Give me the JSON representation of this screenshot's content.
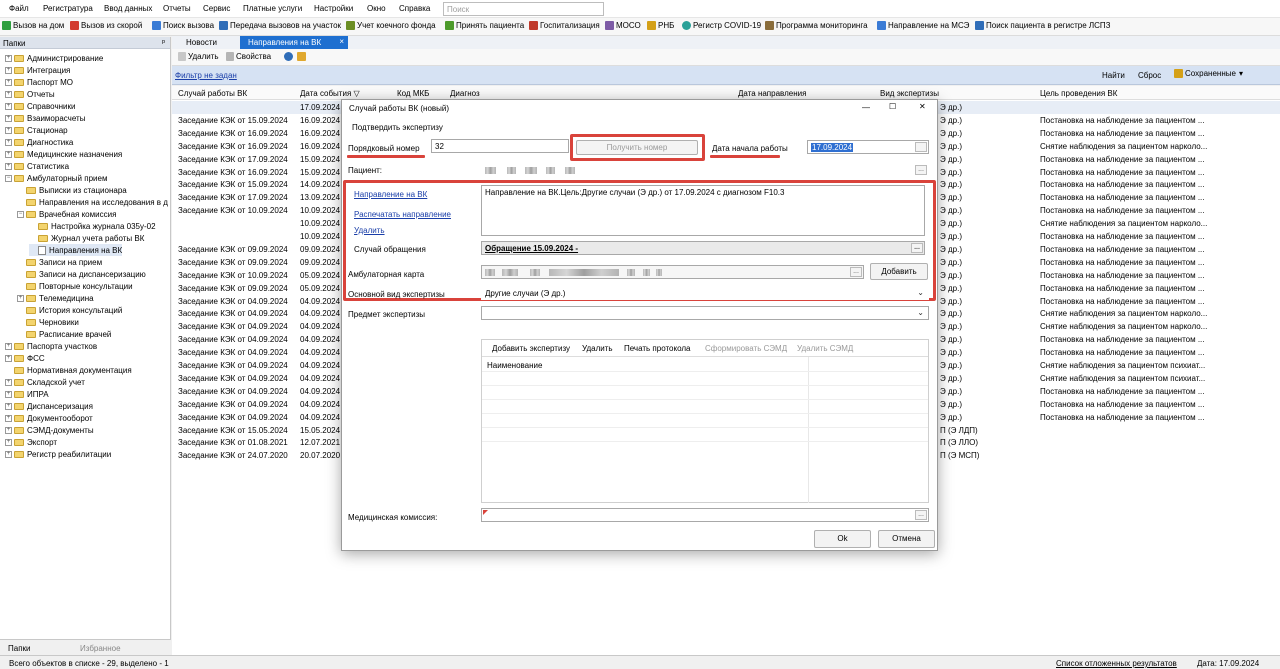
{
  "menu": [
    "Файл",
    "Регистратура",
    "Ввод данных",
    "Отчеты",
    "Сервис",
    "Платные услуги",
    "Настройки",
    "Окно",
    "Справка"
  ],
  "search": {
    "placeholder": "Поиск"
  },
  "toolbar": [
    "Вызов на дом",
    "Вызов из скорой",
    "Поиск вызова",
    "Передача вызовов на участок",
    "Учет коечного фонда",
    "Принять пациента",
    "Госпитализация",
    "МОСО",
    "РНБ",
    "Регистр COVID-19",
    "Программа мониторинга",
    "Направление на МСЭ",
    "Поиск пациента в регистре ЛСПЗ"
  ],
  "toolbar_icon_colors": [
    "#2e9e3e",
    "#d23b2f",
    "#3a7bd5",
    "#2f6db8",
    "#6b8e23",
    "#4c9a2a",
    "#c0392b",
    "#7d5ba6",
    "#d4a017",
    "#2aa198",
    "#8a6d3b",
    "#3a7bd5",
    "#2f6db8"
  ],
  "left_panel": {
    "title": "Папки",
    "pin": "ᵖ",
    "tree": [
      {
        "label": "Администрирование",
        "level": 0,
        "type": "folder",
        "tog": "+"
      },
      {
        "label": "Интеграция",
        "level": 0,
        "type": "folder",
        "tog": "+"
      },
      {
        "label": "Паспорт МО",
        "level": 0,
        "type": "folder",
        "tog": "+"
      },
      {
        "label": "Отчеты",
        "level": 0,
        "type": "folder",
        "tog": "+"
      },
      {
        "label": "Справочники",
        "level": 0,
        "type": "folder",
        "tog": "+"
      },
      {
        "label": "Взаиморасчеты",
        "level": 0,
        "type": "folder",
        "tog": "+"
      },
      {
        "label": "Стационар",
        "level": 0,
        "type": "folder",
        "tog": "+"
      },
      {
        "label": "Диагностика",
        "level": 0,
        "type": "folder",
        "tog": "+"
      },
      {
        "label": "Медицинские назначения",
        "level": 0,
        "type": "folder",
        "tog": "+"
      },
      {
        "label": "Статистика",
        "level": 0,
        "type": "folder",
        "tog": "+"
      },
      {
        "label": "Амбулаторный прием",
        "level": 0,
        "type": "folder",
        "tog": "−"
      },
      {
        "label": "Выписки из стационара",
        "level": 1,
        "type": "folder",
        "tog": ""
      },
      {
        "label": "Направления на исследования в д",
        "level": 1,
        "type": "folder",
        "tog": ""
      },
      {
        "label": "Врачебная комиссия",
        "level": 1,
        "type": "folder",
        "tog": "−"
      },
      {
        "label": "Настройка журнала 035у-02",
        "level": 2,
        "type": "folder",
        "tog": ""
      },
      {
        "label": "Журнал учета работы ВК",
        "level": 2,
        "type": "folder",
        "tog": ""
      },
      {
        "label": "Направления на ВК",
        "level": 2,
        "type": "doc",
        "tog": ""
      },
      {
        "label": "Записи на прием",
        "level": 1,
        "type": "folder",
        "tog": ""
      },
      {
        "label": "Записи на диспансеризацию",
        "level": 1,
        "type": "folder",
        "tog": ""
      },
      {
        "label": "Повторные консультации",
        "level": 1,
        "type": "folder",
        "tog": ""
      },
      {
        "label": "Телемедицина",
        "level": 1,
        "type": "folder",
        "tog": "+"
      },
      {
        "label": "История консультаций",
        "level": 1,
        "type": "folder",
        "tog": ""
      },
      {
        "label": "Черновики",
        "level": 1,
        "type": "folder",
        "tog": ""
      },
      {
        "label": "Расписание врачей",
        "level": 1,
        "type": "folder",
        "tog": ""
      },
      {
        "label": "Паспорта участков",
        "level": 0,
        "type": "folder",
        "tog": "+"
      },
      {
        "label": "ФСС",
        "level": 0,
        "type": "folder",
        "tog": "+"
      },
      {
        "label": "Нормативная документация",
        "level": 0,
        "type": "folder",
        "tog": ""
      },
      {
        "label": "Складской учет",
        "level": 0,
        "type": "folder",
        "tog": "+"
      },
      {
        "label": "ИПРА",
        "level": 0,
        "type": "folder",
        "tog": "+"
      },
      {
        "label": "Диспансеризация",
        "level": 0,
        "type": "folder",
        "tog": "+"
      },
      {
        "label": "Документооборот",
        "level": 0,
        "type": "folder",
        "tog": "+"
      },
      {
        "label": "СЭМД-документы",
        "level": 0,
        "type": "folder",
        "tog": "+"
      },
      {
        "label": "Экспорт",
        "level": 0,
        "type": "folder",
        "tog": "+"
      },
      {
        "label": "Регистр реабилитации",
        "level": 0,
        "type": "folder",
        "tog": "+"
      }
    ],
    "tabs": [
      "Папки",
      "Избранное"
    ]
  },
  "doc_tabs": [
    "Новости",
    "Направления на ВК"
  ],
  "doc_tab_close": "×",
  "subtoolbar": {
    "delete": "Удалить",
    "props": "Свойства"
  },
  "filter": {
    "label": "Фильтр не задан",
    "find": "Найти",
    "reset": "Сброс",
    "saved": "Сохраненные"
  },
  "grid": {
    "columns": [
      "Случай работы ВК",
      "Дата события",
      "Код МКБ",
      "Диагноз",
      "Дата направления",
      "Вид экспертизы",
      "Цель проведения ВК"
    ],
    "rows": [
      {
        "case": "",
        "date": "17.09.2024",
        "kind": "Э др.)",
        "goal": ""
      },
      {
        "case": "Заседание КЭК от 15.09.2024",
        "date": "16.09.2024",
        "kind": "Э др.)",
        "goal": "Постановка на наблюдение за пациентом ..."
      },
      {
        "case": "Заседание КЭК от 16.09.2024",
        "date": "16.09.2024",
        "kind": "Э др.)",
        "goal": "Постановка на наблюдение за пациентом ..."
      },
      {
        "case": "Заседание КЭК от 16.09.2024",
        "date": "16.09.2024",
        "kind": "Э др.)",
        "goal": "Снятие наблюдения за пациентом нарколо..."
      },
      {
        "case": "Заседание КЭК от 17.09.2024",
        "date": "15.09.2024",
        "kind": "Э др.)",
        "goal": "Постановка на наблюдение за пациентом ..."
      },
      {
        "case": "Заседание КЭК от 16.09.2024",
        "date": "15.09.2024",
        "kind": "Э др.)",
        "goal": "Постановка на наблюдение за пациентом ..."
      },
      {
        "case": "Заседание КЭК от 15.09.2024",
        "date": "14.09.2024",
        "kind": "Э др.)",
        "goal": "Постановка на наблюдение за пациентом ..."
      },
      {
        "case": "Заседание КЭК от 17.09.2024",
        "date": "13.09.2024",
        "kind": "Э др.)",
        "goal": "Постановка на наблюдение за пациентом ..."
      },
      {
        "case": "Заседание КЭК от 10.09.2024",
        "date": "10.09.2024",
        "kind": "Э др.)",
        "goal": "Постановка на наблюдение за пациентом ..."
      },
      {
        "case": "",
        "date": "10.09.2024",
        "kind": "Э др.)",
        "goal": "Снятие наблюдения за пациентом нарколо..."
      },
      {
        "case": "",
        "date": "10.09.2024",
        "kind": "Э др.)",
        "goal": "Постановка на наблюдение за пациентом ..."
      },
      {
        "case": "Заседание КЭК от 09.09.2024",
        "date": "09.09.2024",
        "kind": "Э др.)",
        "goal": "Постановка на наблюдение за пациентом ..."
      },
      {
        "case": "Заседание КЭК от 09.09.2024",
        "date": "09.09.2024",
        "kind": "Э др.)",
        "goal": "Постановка на наблюдение за пациентом ..."
      },
      {
        "case": "Заседание КЭК от 10.09.2024",
        "date": "05.09.2024",
        "kind": "Э др.)",
        "goal": "Постановка на наблюдение за пациентом ..."
      },
      {
        "case": "Заседание КЭК от 09.09.2024",
        "date": "05.09.2024",
        "kind": "Э др.)",
        "goal": "Постановка на наблюдение за пациентом ..."
      },
      {
        "case": "Заседание КЭК от 04.09.2024",
        "date": "04.09.2024",
        "kind": "Э др.)",
        "goal": "Постановка на наблюдение за пациентом ..."
      },
      {
        "case": "Заседание КЭК от 04.09.2024",
        "date": "04.09.2024",
        "kind": "Э др.)",
        "goal": "Снятие наблюдения за пациентом нарколо..."
      },
      {
        "case": "Заседание КЭК от 04.09.2024",
        "date": "04.09.2024",
        "kind": "Э др.)",
        "goal": "Снятие наблюдения за пациентом нарколо..."
      },
      {
        "case": "Заседание КЭК от 04.09.2024",
        "date": "04.09.2024",
        "kind": "Э др.)",
        "goal": "Постановка на наблюдение за пациентом ..."
      },
      {
        "case": "Заседание КЭК от 04.09.2024",
        "date": "04.09.2024",
        "kind": "Э др.)",
        "goal": "Постановка на наблюдение за пациентом ..."
      },
      {
        "case": "Заседание КЭК от 04.09.2024",
        "date": "04.09.2024",
        "kind": "Э др.)",
        "goal": "Снятие наблюдения за пациентом психиат..."
      },
      {
        "case": "Заседание КЭК от 04.09.2024",
        "date": "04.09.2024",
        "kind": "Э др.)",
        "goal": "Снятие наблюдения за пациентом психиат..."
      },
      {
        "case": "Заседание КЭК от 04.09.2024",
        "date": "04.09.2024",
        "kind": "Э др.)",
        "goal": "Постановка на наблюдение за пациентом ..."
      },
      {
        "case": "Заседание КЭК от 04.09.2024",
        "date": "04.09.2024",
        "kind": "Э др.)",
        "goal": "Постановка на наблюдение за пациентом ..."
      },
      {
        "case": "Заседание КЭК от 04.09.2024",
        "date": "04.09.2024",
        "kind": "Э др.)",
        "goal": "Постановка на наблюдение за пациентом ..."
      },
      {
        "case": "Заседание КЭК от 15.05.2024",
        "date": "15.05.2024",
        "kind": "П (Э ЛДП)",
        "goal": ""
      },
      {
        "case": "Заседание КЭК от 01.08.2021",
        "date": "12.07.2021",
        "kind": "П (Э ЛЛО)",
        "goal": ""
      },
      {
        "case": "Заседание КЭК от 24.07.2020",
        "date": "20.07.2020",
        "kind": "П (Э МСП)",
        "goal": ""
      }
    ]
  },
  "status": {
    "left": "Всего объектов в списке - 29, выделено - 1",
    "deferred": "Список отложенных результатов",
    "date": "Дата: 17.09.2024"
  },
  "dialog": {
    "title": "Случай работы ВК (новый)",
    "win_min": "—",
    "win_max": "☐",
    "win_close": "✕",
    "confirm": "Подтвердить экспертизу",
    "number_label": "Порядковый номер",
    "number_value": "32",
    "get_number": "Получить номер",
    "start_date_label": "Дата начала работы",
    "start_date_value": "17.09.2024",
    "patient_label": "Пациент:",
    "ellipsis": "...",
    "links": [
      "Направление на ВК",
      "Распечатать направление",
      "Удалить"
    ],
    "direction_text": "Направление на ВК.Цель:Другие случаи (Э др.) от 17.09.2024 с диагнозом F10.3",
    "case_label": "Случай обращения",
    "case_value": "Обращение 15.09.2024 -",
    "card_label": "Амбулаторная карта",
    "add_button": "Добавить",
    "exam_kind_label": "Основной вид экспертизы",
    "exam_kind_value": "Другие случаи (Э др.)",
    "subject_label": "Предмет экспертизы",
    "exp_toolbar": [
      "Добавить экспертизу",
      "Удалить",
      "Печать протокола",
      "Сформировать СЭМД",
      "Удалить СЭМД"
    ],
    "exp_col": "Наименование",
    "commission_label": "Медицинская комиссия:",
    "ok": "Ok",
    "cancel": "Отмена"
  },
  "accent": {
    "highlight": "#d9433b",
    "link": "#1a3ea8",
    "selection": "#2f6fd1"
  }
}
